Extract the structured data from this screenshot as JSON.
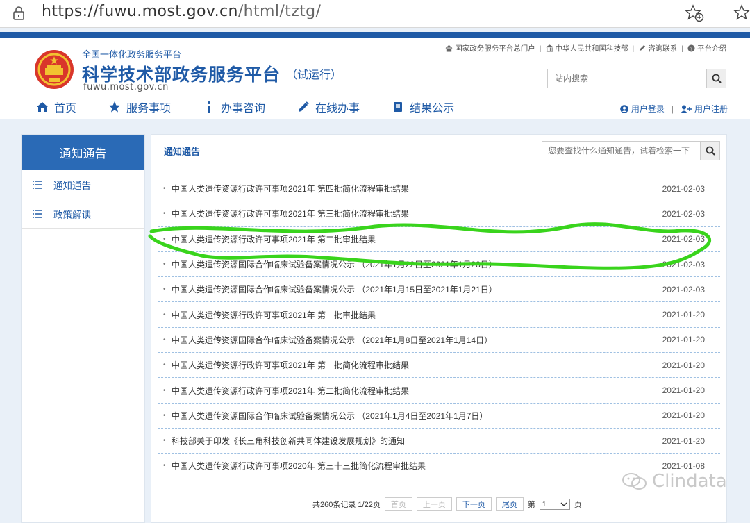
{
  "browser": {
    "url_main": "https://fuwu.most.gov.cn",
    "url_path": "/html/tztg/"
  },
  "header": {
    "site_subtitle": "全国一体化政务服务平台",
    "site_title": "科学技术部政务服务平台",
    "site_trial": "（试运行）",
    "site_domain": "fuwu.most.gov.cn",
    "top_links": [
      "国家政务服务平台总门户",
      "中华人民共和国科技部",
      "咨询联系",
      "平台介绍"
    ],
    "search_placeholder": "站内搜索",
    "nav": [
      "首页",
      "服务事项",
      "办事咨询",
      "在线办事",
      "结果公示"
    ],
    "login": "用户登录",
    "register": "用户注册"
  },
  "sidebar": {
    "title": "通知通告",
    "items": [
      "通知通告",
      "政策解读"
    ]
  },
  "main": {
    "title": "通知通告",
    "search_placeholder": "您要查找什么通知通告，试着检索一下",
    "rows": [
      {
        "title": "中国人类遗传资源行政许可事项2021年 第四批简化流程审批结果",
        "date": "2021-02-03"
      },
      {
        "title": "中国人类遗传资源行政许可事项2021年 第三批简化流程审批结果",
        "date": "2021-02-03"
      },
      {
        "title": "中国人类遗传资源行政许可事项2021年 第二批审批结果",
        "date": "2021-02-03"
      },
      {
        "title": "中国人类遗传资源国际合作临床试验备案情况公示 （2021年1月22日至2021年1月28日）",
        "date": "2021-02-03"
      },
      {
        "title": "中国人类遗传资源国际合作临床试验备案情况公示 （2021年1月15日至2021年1月21日）",
        "date": "2021-02-03"
      },
      {
        "title": "中国人类遗传资源行政许可事项2021年 第一批审批结果",
        "date": "2021-01-20"
      },
      {
        "title": "中国人类遗传资源国际合作临床试验备案情况公示 （2021年1月8日至2021年1月14日）",
        "date": "2021-01-20"
      },
      {
        "title": "中国人类遗传资源行政许可事项2021年 第一批简化流程审批结果",
        "date": "2021-01-20"
      },
      {
        "title": "中国人类遗传资源行政许可事项2021年 第二批简化流程审批结果",
        "date": "2021-01-20"
      },
      {
        "title": "中国人类遗传资源国际合作临床试验备案情况公示 （2021年1月4日至2021年1月7日）",
        "date": "2021-01-20"
      },
      {
        "title": "科技部关于印发《长三角科技创新共同体建设发展规划》的通知",
        "date": "2021-01-20"
      },
      {
        "title": "中国人类遗传资源行政许可事项2020年 第三十三批简化流程审批结果",
        "date": "2021-01-08"
      }
    ],
    "pager": {
      "summary": "共260条记录 1/22页",
      "first": "首页",
      "prev": "上一页",
      "next": "下一页",
      "last": "尾页",
      "page_prefix": "第",
      "page_value": "1",
      "page_suffix": "页"
    }
  },
  "watermark": "Clindata",
  "colors": {
    "brand": "#1f5aa6",
    "highlight": "#39d41c"
  }
}
